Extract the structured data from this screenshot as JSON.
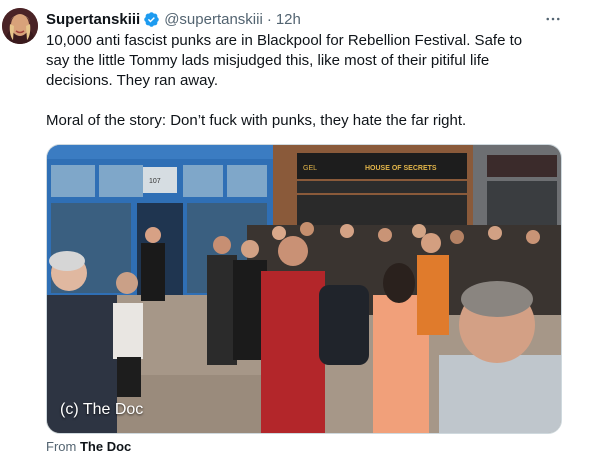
{
  "author": {
    "display_name": "Supertanskiii",
    "handle": "@supertanskiii",
    "separator": "·",
    "time": "12h",
    "verified": true,
    "verified_color": "#1d9bf0"
  },
  "more_icon": "ellipsis-icon",
  "tweet": {
    "paragraph_1": "10,000 anti fascist punks are in Blackpool for Rebellion Festival. Safe to say the little Tommy lads misjudged this, like most of their pitiful life decisions. They ran away.",
    "paragraph_2": "Moral of the story: Don’t fuck with punks, they hate the far right."
  },
  "media": {
    "watermark": "(c) The Doc",
    "storefront_left_sign": "107",
    "storefront_right_sign": "HOUSE OF SECRETS",
    "storefront_right_small": "GEL"
  },
  "source": {
    "prefix": "From",
    "name": "The Doc"
  },
  "colors": {
    "text_primary": "#0f1419",
    "text_secondary": "#536471",
    "accent": "#1d9bf0"
  }
}
